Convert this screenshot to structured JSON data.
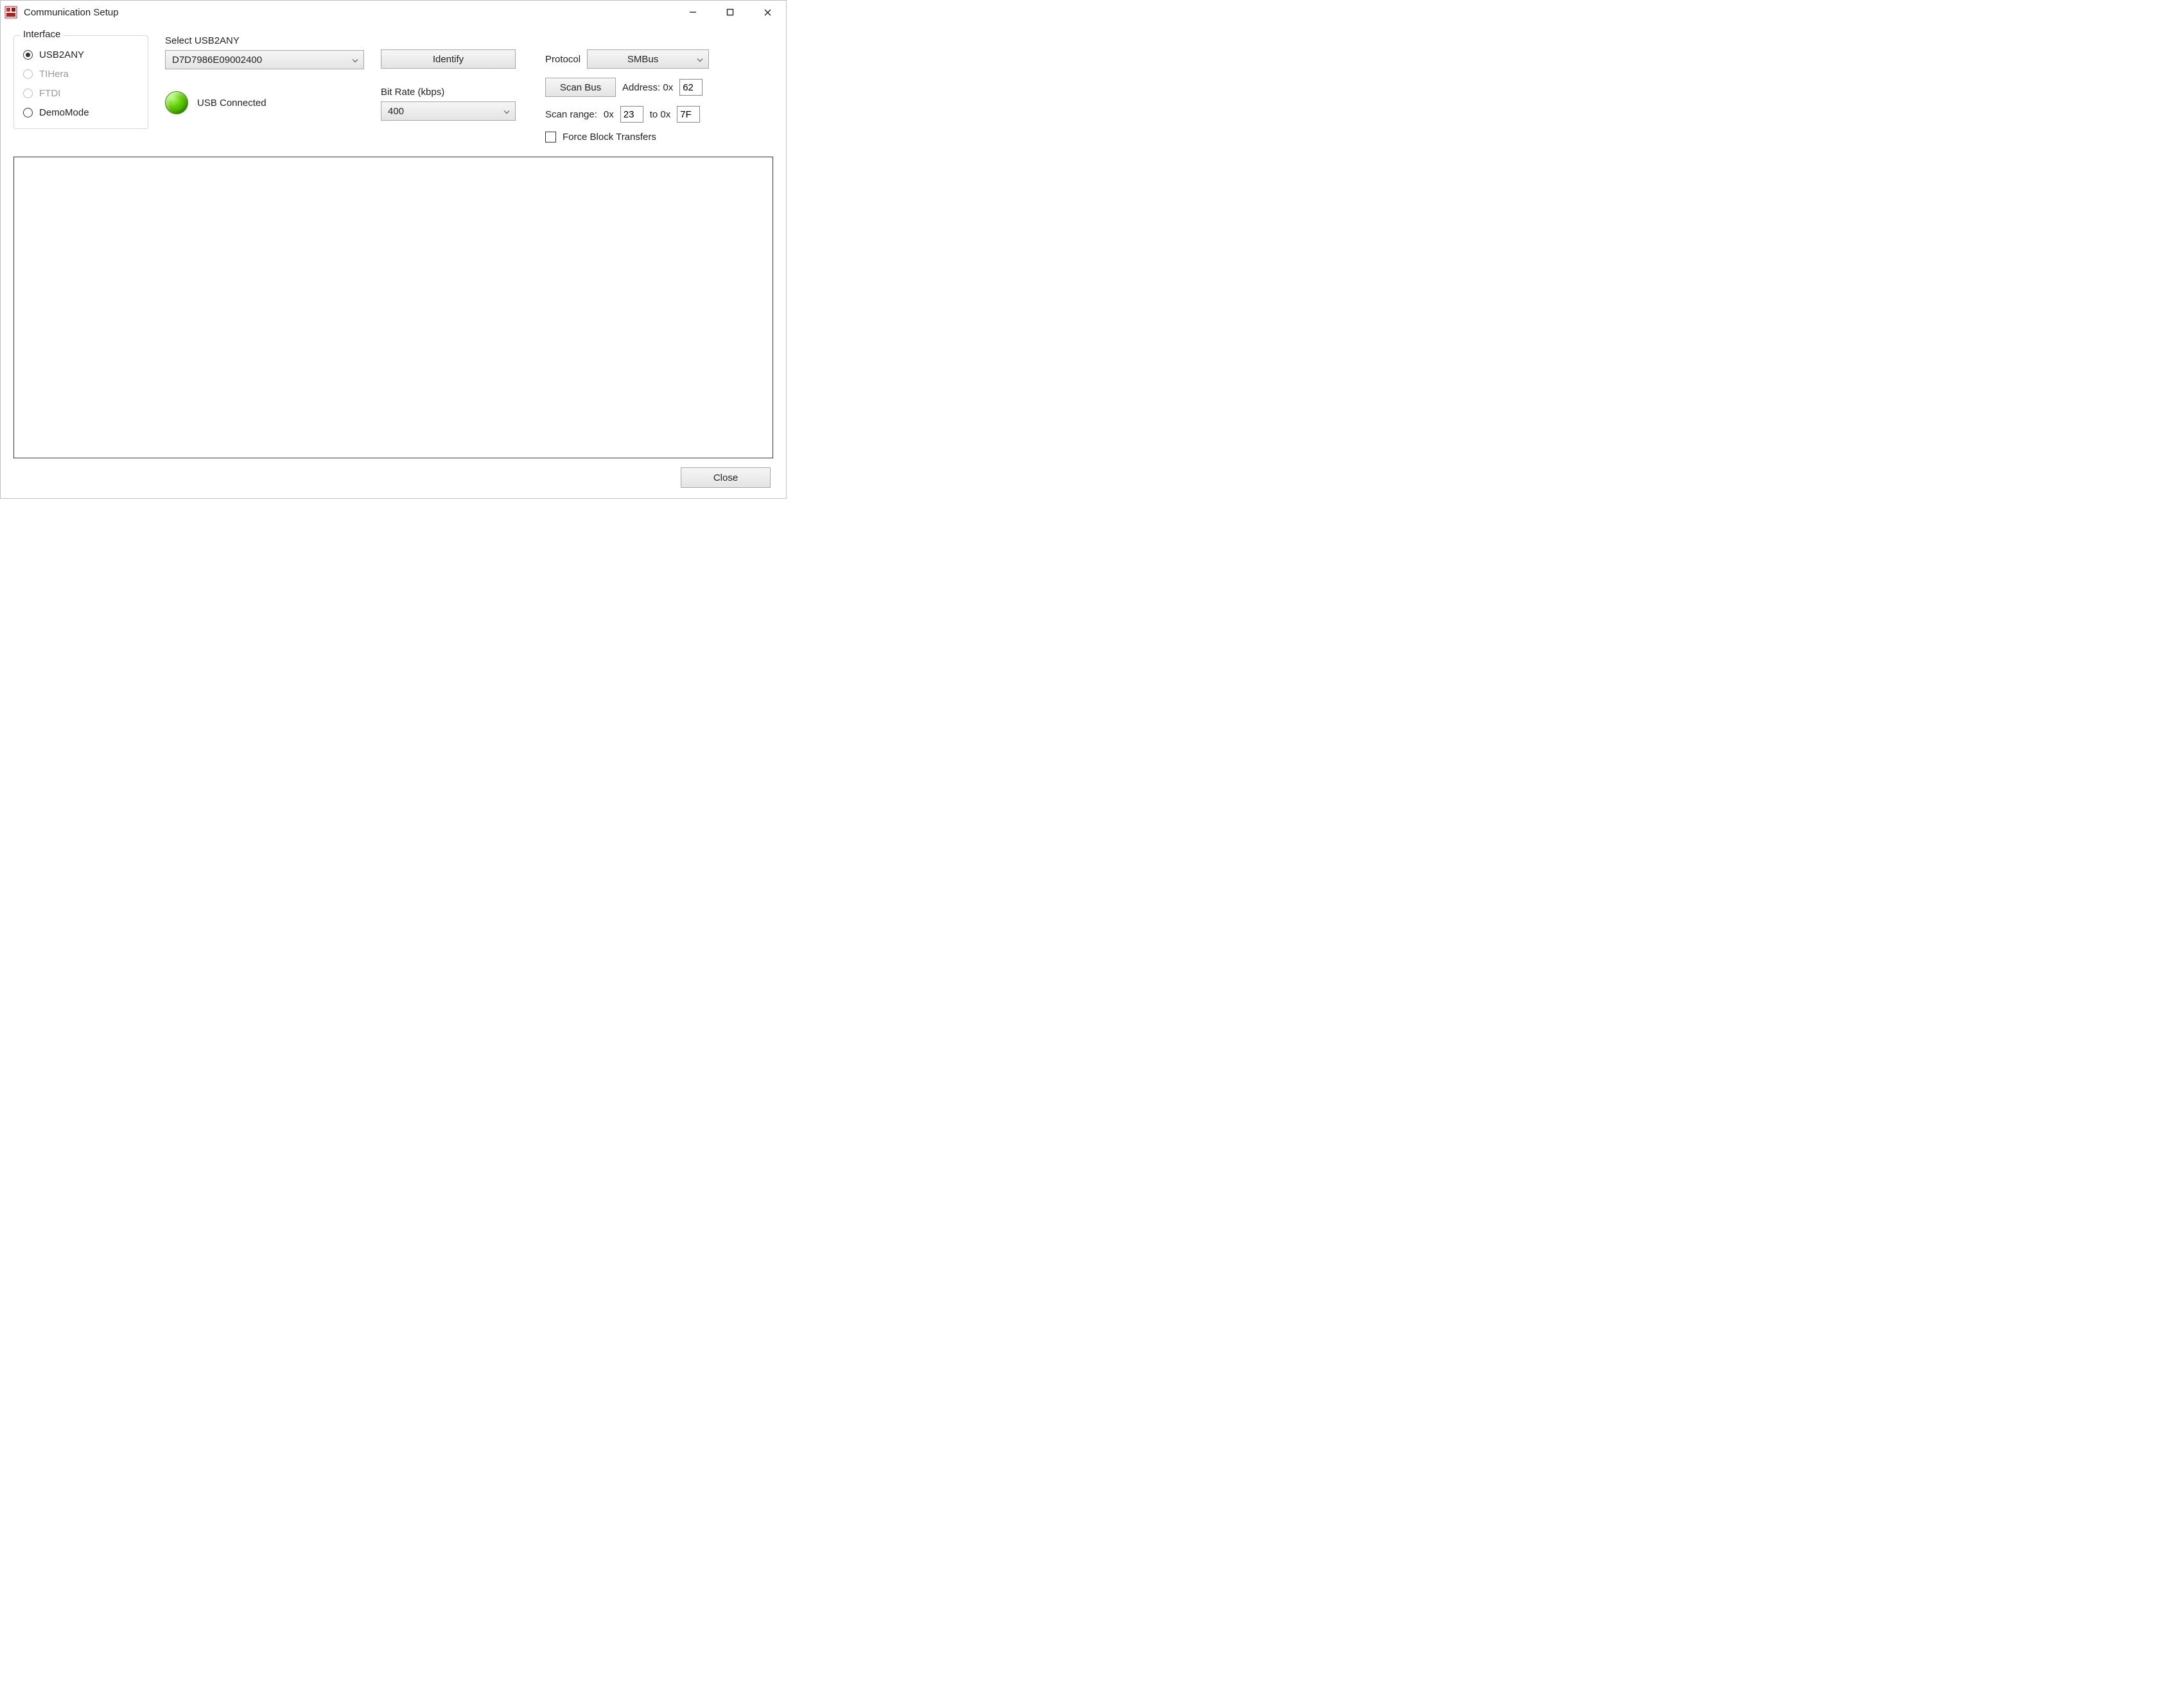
{
  "window": {
    "title": "Communication Setup"
  },
  "interface": {
    "legend": "Interface",
    "options": {
      "usb2any": "USB2ANY",
      "tihera": "TIHera",
      "ftdi": "FTDI",
      "demomode": "DemoMode"
    },
    "selected": "usb2any"
  },
  "usb": {
    "select_label": "Select USB2ANY",
    "device_id": "D7D7986E09002400",
    "status_text": "USB Connected"
  },
  "identify_label": "Identify",
  "bitrate": {
    "label": "Bit Rate (kbps)",
    "value": "400"
  },
  "protocol": {
    "label": "Protocol",
    "value": "SMBus"
  },
  "scan": {
    "button_label": "Scan Bus",
    "address_label": "Address: 0x",
    "address_value": "62",
    "range_label": "Scan range:",
    "hex_prefix": "0x",
    "hex_to": "to 0x",
    "range_from": "23",
    "range_to": "7F"
  },
  "force_block_label": "Force Block Transfers",
  "close_label": "Close"
}
